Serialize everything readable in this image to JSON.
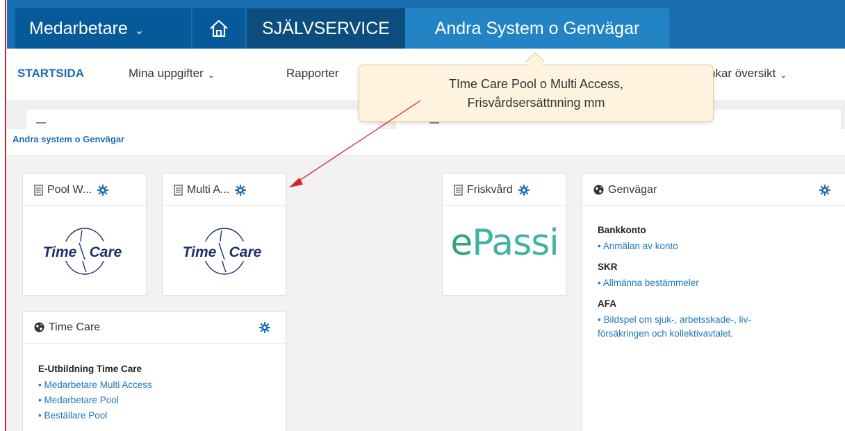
{
  "topnav": {
    "medarbetare_label": "Medarbetare",
    "sjalvservice_label": "SJÄLVSERVICE",
    "andra_label": "Andra System o Genvägar"
  },
  "subnav": {
    "startsida": "STARTSIDA",
    "mina": "Mina uppgifter",
    "rapporter": "Rapporter",
    "lankar": "nkar översikt"
  },
  "tooltip": {
    "line1": "TIme Care Pool o Multi Access,",
    "line2": "Frisvårdsersättnning mm"
  },
  "section": {
    "title": "Andra system o Genvägar"
  },
  "cards": {
    "pool": {
      "title": "Pool W...",
      "logo_left": "Time",
      "logo_right": "Care"
    },
    "multi": {
      "title": "Multi A...",
      "logo_left": "Time",
      "logo_right": "Care"
    },
    "friskvard": {
      "title": "Friskvård",
      "logo_e": "e",
      "logo_rest": "Passi"
    },
    "timecare": {
      "title": "Time Care",
      "group": "E-Utbildning Time Care",
      "links": [
        "• Medarbetare Multi Access",
        "• Medarbetare Pool",
        "• Beställare Pool"
      ]
    },
    "genvagar": {
      "title": "Genvägar",
      "group1": "Bankkonto",
      "link1": "• Anmälan av konto",
      "group2": "SKR",
      "link2": "• Allmänna bestämmeler",
      "group3": "AFA",
      "link3": "• Bildspel om sjuk-, arbetsskade-, liv-försäkringen och kollektivavtalet."
    }
  },
  "colors": {
    "topbar": "#1a6fb0",
    "accent": "#1c6fb3",
    "tooltip_bg": "#fdf3df",
    "annotation_red": "#e02020"
  }
}
